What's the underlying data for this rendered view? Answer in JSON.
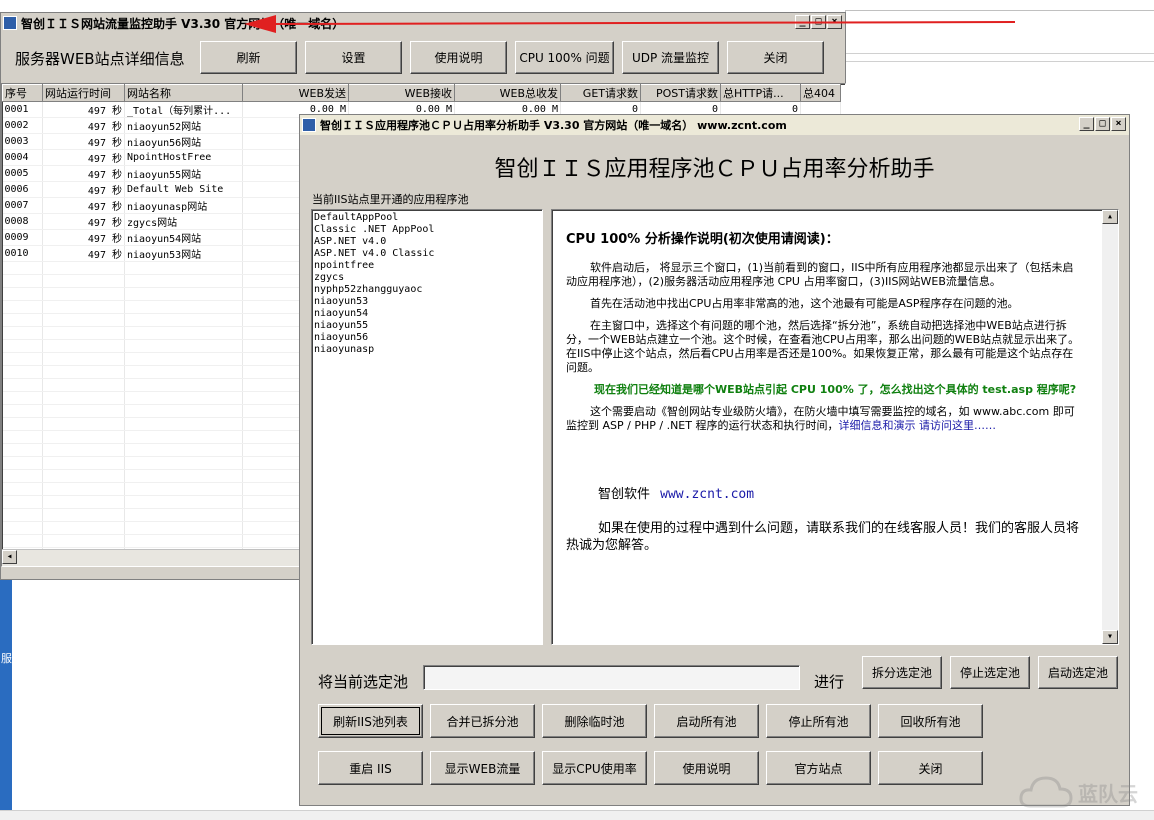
{
  "desktop": {
    "bg": "#ffffff",
    "left_strip_label": "服"
  },
  "main_window": {
    "title": "智创ＩＩＳ网站流量监控助手 V3.30 官方网站（唯一域名）",
    "header_label": "服务器WEB站点详细信息",
    "buttons": [
      {
        "label": "刷新"
      },
      {
        "label": "设置"
      },
      {
        "label": "使用说明"
      },
      {
        "label": "CPU 100% 问题"
      },
      {
        "label": "UDP 流量监控"
      },
      {
        "label": "关闭"
      }
    ],
    "table": {
      "headers": [
        "序号",
        "网站运行时间",
        "网站名称",
        "WEB发送",
        "WEB接收",
        "WEB总收发",
        "GET请求数",
        "POST请求数",
        "总HTTP请...",
        "总404"
      ],
      "rows": [
        [
          "0001",
          "497 秒",
          "_Total（每列累计...",
          "0.00 M",
          "0.00 M",
          "0.00 M",
          "0",
          "0",
          "0",
          ""
        ],
        [
          "0002",
          "497 秒",
          "niaoyun52网站",
          "",
          "",
          "",
          "",
          "",
          "",
          ""
        ],
        [
          "0003",
          "497 秒",
          "niaoyun56网站",
          "",
          "",
          "",
          "",
          "",
          "",
          ""
        ],
        [
          "0004",
          "497 秒",
          "NpointHostFree",
          "",
          "",
          "",
          "",
          "",
          "",
          ""
        ],
        [
          "0005",
          "497 秒",
          "niaoyun55网站",
          "",
          "",
          "",
          "",
          "",
          "",
          ""
        ],
        [
          "0006",
          "497 秒",
          "Default Web Site",
          "",
          "",
          "",
          "",
          "",
          "",
          ""
        ],
        [
          "0007",
          "497 秒",
          "niaoyunasp网站",
          "",
          "",
          "",
          "",
          "",
          "",
          ""
        ],
        [
          "0008",
          "497 秒",
          "zgycs网站",
          "",
          "",
          "",
          "",
          "",
          "",
          ""
        ],
        [
          "0009",
          "497 秒",
          "niaoyun54网站",
          "",
          "",
          "",
          "",
          "",
          "",
          ""
        ],
        [
          "0010",
          "497 秒",
          "niaoyun53网站",
          "",
          "",
          "",
          "",
          "",
          "",
          ""
        ]
      ]
    }
  },
  "arrow_color": "#e02020",
  "cpu_window": {
    "title": "智创ＩＩＳ应用程序池ＣＰＵ占用率分析助手 V3.30 官方网站（唯一域名） www.zcnt.com",
    "heading": "智创ＩＩＳ应用程序池ＣＰＵ占用率分析助手",
    "pool_list_label": "当前IIS站点里开通的应用程序池",
    "pools": [
      "DefaultAppPool",
      "Classic .NET AppPool",
      "ASP.NET v4.0",
      "ASP.NET v4.0 Classic",
      "npointfree",
      "zgycs",
      "nyphp52zhangguyaoc",
      "niaoyun53",
      "niaoyun54",
      "niaoyun55",
      "niaoyun56",
      "niaoyunasp"
    ],
    "help": {
      "title": "CPU 100% 分析操作说明(初次使用请阅读)：",
      "p1": "软件启动后， 将显示三个窗口，(1)当前看到的窗口，IIS中所有应用程序池都显示出来了（包括未启动应用程序池），(2)服务器活动应用程序池 CPU 占用率窗口，(3)IIS网站WEB流量信息。",
      "p2": "首先在活动池中找出CPU占用率非常高的池，这个池最有可能是ASP程序存在问题的池。",
      "p3": "在主窗口中，选择这个有问题的哪个池，然后选择“拆分池”，系统自动把选择池中WEB站点进行拆分，一个WEB站点建立一个池。这个时候，在查看池CPU占用率，那么出问题的WEB站点就显示出来了。 在IIS中停止这个站点，然后看CPU占用率是否还是100%。如果恢复正常，那么最有可能是这个站点存在问题。",
      "p4": "现在我们已经知道是哪个WEB站点引起 CPU 100% 了，怎么找出这个具体的 test.asp 程序呢?",
      "p5_text": "这个需要启动《智创网站专业级防火墙》，在防火墙中填写需要监控的域名，如 www.abc.com 即可监控到 ASP / PHP / .NET 程序的运行状态和执行时间，",
      "p5_link": "详细信息和演示 请访问这里……",
      "company": "智创软件",
      "company_url": "www.zcnt.com",
      "contact": "如果在使用的过程中遇到什么问题，请联系我们的在线客服人员！我们的客服人员将热诚为您解答。"
    },
    "selected_label": "将当前选定池",
    "selected_value": "",
    "go_label": "进行",
    "action_buttons": [
      {
        "label": "拆分选定池"
      },
      {
        "label": "停止选定池"
      },
      {
        "label": "启动选定池"
      }
    ],
    "row1_buttons": [
      {
        "label": "刷新IIS池列表"
      },
      {
        "label": "合并已拆分池"
      },
      {
        "label": "删除临时池"
      },
      {
        "label": "启动所有池"
      },
      {
        "label": "停止所有池"
      },
      {
        "label": "回收所有池"
      }
    ],
    "row2_buttons": [
      {
        "label": "重启 IIS"
      },
      {
        "label": "显示WEB流量"
      },
      {
        "label": "显示CPU使用率"
      },
      {
        "label": "使用说明"
      },
      {
        "label": "官方站点"
      },
      {
        "label": "关闭"
      }
    ],
    "link_color": "#1a1aa8",
    "highlight_color": "#108010"
  },
  "watermark": "蓝队云"
}
